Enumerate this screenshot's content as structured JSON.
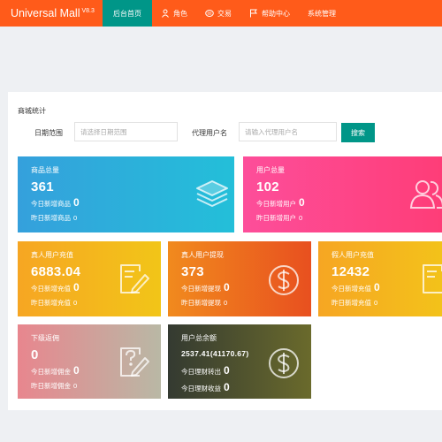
{
  "header": {
    "app_name": "Universal Mall",
    "version": "V8.3",
    "nav": [
      {
        "label": "后台首页",
        "icon": ""
      },
      {
        "label": "角色",
        "icon": "user-icon"
      },
      {
        "label": "交易",
        "icon": "exchange-icon"
      },
      {
        "label": "帮助中心",
        "icon": "flag-icon"
      },
      {
        "label": "系统管理",
        "icon": ""
      }
    ]
  },
  "stats": {
    "title": "商城统计",
    "date_label": "日期范围",
    "date_placeholder": "请选择日期范围",
    "agent_label": "代理用户名",
    "agent_placeholder": "请输入代理用户名",
    "search_label": "搜索"
  },
  "cards": {
    "products": {
      "title": "商品总量",
      "value": "361",
      "l1_label": "今日新增商品",
      "l1_value": "0",
      "l2_label": "昨日新增商品",
      "l2_value": "0",
      "icon": "layers-icon"
    },
    "users": {
      "title": "用户总量",
      "value": "102",
      "l1_label": "今日新增用户",
      "l1_value": "0",
      "l2_label": "昨日新增用户",
      "l2_value": "0",
      "icon": "users-icon"
    },
    "real_recharge": {
      "title": "真人用户充值",
      "value": "6883.04",
      "l1_label": "今日新增充值",
      "l1_value": "0",
      "l2_label": "昨日新增充值",
      "l2_value": "0",
      "icon": "edit-icon"
    },
    "real_withdraw": {
      "title": "真人用户提现",
      "value": "373",
      "l1_label": "今日新增提现",
      "l1_value": "0",
      "l2_label": "昨日新增提现",
      "l2_value": "0",
      "icon": "dollar-icon"
    },
    "fake_recharge": {
      "title": "假人用户充值",
      "value": "12432",
      "l1_label": "今日新增充值",
      "l1_value": "0",
      "l2_label": "昨日新增充值",
      "l2_value": "0",
      "icon": "edit-icon"
    },
    "rebate": {
      "title": "下级返佣",
      "value": "0",
      "l1_label": "今日新增佣金",
      "l1_value": "0",
      "l2_label": "昨日新增佣金",
      "l2_value": "0",
      "icon": "help-icon"
    },
    "balance": {
      "title": "用户总余额",
      "value": "2537.41(41170.67)",
      "l1_label": "今日理财转出",
      "l1_value": "0",
      "l2_label": "今日理财收益",
      "l2_value": "0",
      "icon": "dollar-icon"
    }
  }
}
